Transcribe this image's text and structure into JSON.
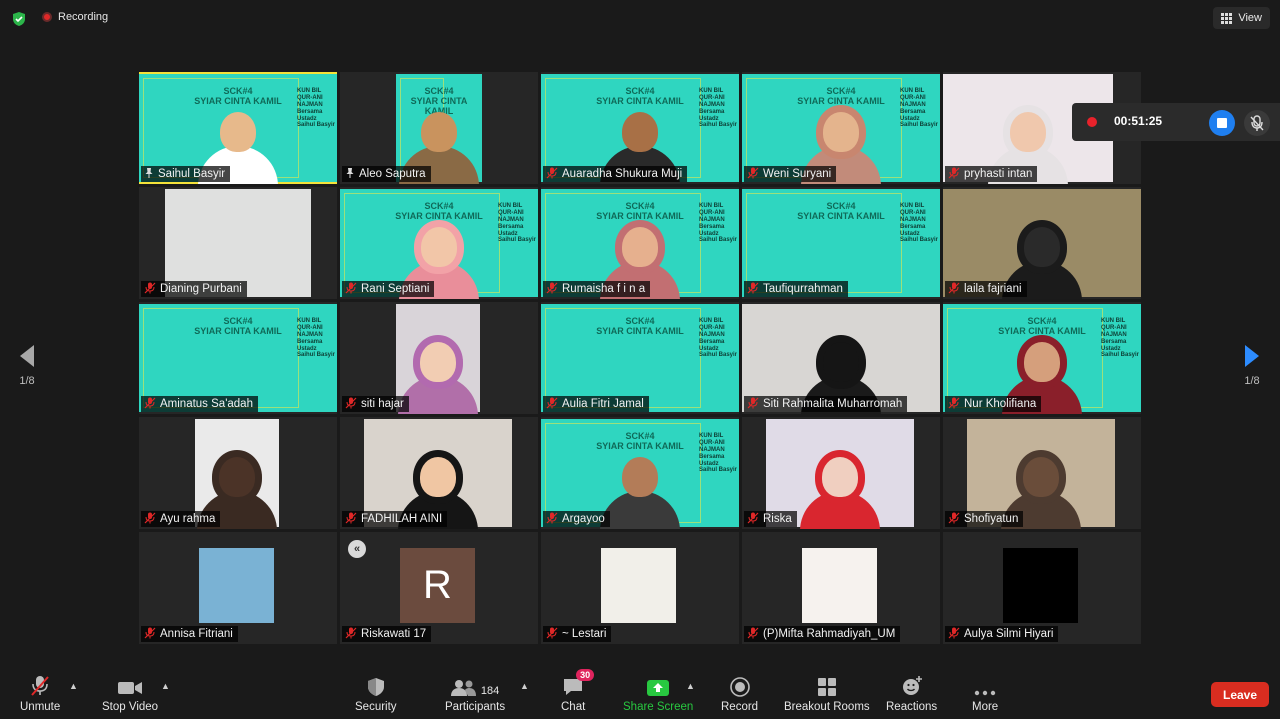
{
  "topbar": {
    "recording_label": "Recording",
    "view_label": "View"
  },
  "recording_panel": {
    "time": "00:51:25"
  },
  "slide": {
    "title": "SCK#4\nSYIAR CINTA KAMIL",
    "side": "KUN BIL QUR-ANI NAJMAN\nBersama Ustadz Saihul Basyir"
  },
  "pager": {
    "left": "1/8",
    "right": "1/8"
  },
  "participants": [
    {
      "name": "Saihul Basyir",
      "active": true,
      "pinned": true
    },
    {
      "name": "Aleo Saputra",
      "pinned": true
    },
    {
      "name": "Auaradha Shukura Muji"
    },
    {
      "name": "Weni Suryani"
    },
    {
      "name": "pryhasti intan"
    },
    {
      "name": "Dianing Purbani"
    },
    {
      "name": "Rani Septiani"
    },
    {
      "name": "Rumaisha f i n a"
    },
    {
      "name": "Taufiqurrahman"
    },
    {
      "name": "laila fajriani"
    },
    {
      "name": "Aminatus Sa'adah"
    },
    {
      "name": "siti hajar"
    },
    {
      "name": "Aulia Fitri Jamal"
    },
    {
      "name": "Siti Rahmalita Muharromah"
    },
    {
      "name": "Nur Kholifiana"
    },
    {
      "name": "Ayu rahma"
    },
    {
      "name": "FADHILAH AINI"
    },
    {
      "name": "Argayoo"
    },
    {
      "name": "Riska"
    },
    {
      "name": "Shofiyatun"
    },
    {
      "name": "Annisa Fitriani"
    },
    {
      "name": "Riskawati 17",
      "avatar_letter": "R"
    },
    {
      "name": "~ Lestari"
    },
    {
      "name": "(P)Mifta Rahmadiyah_UM"
    },
    {
      "name": "Aulya Silmi Hiyari"
    }
  ],
  "toolbar": {
    "unmute": "Unmute",
    "stop_video": "Stop Video",
    "security": "Security",
    "participants": "Participants",
    "participants_count": "184",
    "chat": "Chat",
    "chat_badge": "30",
    "share_screen": "Share Screen",
    "record": "Record",
    "breakout_rooms": "Breakout Rooms",
    "reactions": "Reactions",
    "more": "More",
    "leave": "Leave"
  },
  "colors": {
    "accent": "#2fd6c0",
    "active_border": "#f4e23a",
    "leave": "#d92d20",
    "share": "#28c840"
  }
}
